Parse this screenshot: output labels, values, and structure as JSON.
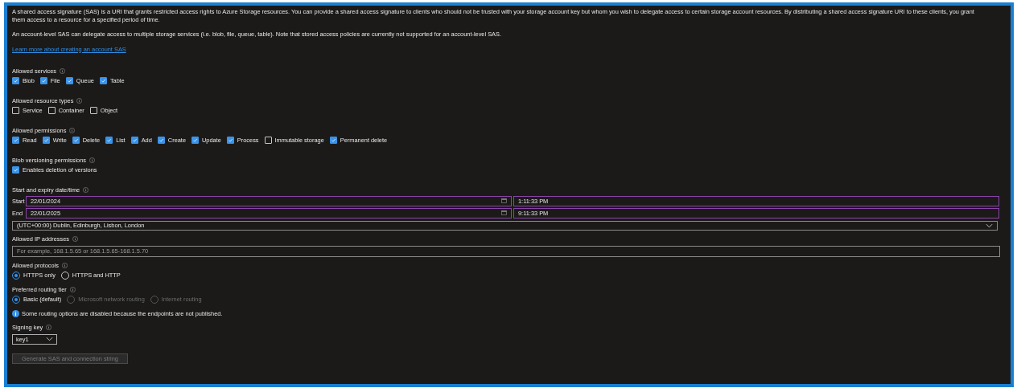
{
  "intro": [
    {
      "kind": "text",
      "text": "A shared access signature (SAS) is a URI that grants restricted access rights to Azure Storage resources. You can provide a shared access signature to clients who should not be trusted with your storage account key but whom you wish to delegate access to certain storage account resources. By distributing a shared access signature URI to these clients, you grant them access to a resource for a specified period of time."
    },
    {
      "kind": "text",
      "text": "An account-level SAS can delegate access to multiple storage services (i.e. blob, file, queue, table). Note that stored access policies are currently not supported for an account-level SAS."
    },
    {
      "kind": "link",
      "text": "Learn more about creating an account SAS"
    }
  ],
  "sections": [
    {
      "kind": "checkboxes",
      "label": "Allowed services",
      "options": [
        {
          "label": "Blob",
          "checked": true
        },
        {
          "label": "File",
          "checked": true
        },
        {
          "label": "Queue",
          "checked": true
        },
        {
          "label": "Table",
          "checked": true
        }
      ]
    },
    {
      "kind": "checkboxes",
      "label": "Allowed resource types",
      "options": [
        {
          "label": "Service",
          "checked": false
        },
        {
          "label": "Container",
          "checked": false
        },
        {
          "label": "Object",
          "checked": false
        }
      ]
    },
    {
      "kind": "checkboxes",
      "label": "Allowed permissions",
      "options": [
        {
          "label": "Read",
          "checked": true
        },
        {
          "label": "Write",
          "checked": true
        },
        {
          "label": "Delete",
          "checked": true
        },
        {
          "label": "List",
          "checked": true
        },
        {
          "label": "Add",
          "checked": true
        },
        {
          "label": "Create",
          "checked": true
        },
        {
          "label": "Update",
          "checked": true
        },
        {
          "label": "Process",
          "checked": true
        },
        {
          "label": "Immutable storage",
          "checked": false
        },
        {
          "label": "Permanent delete",
          "checked": true
        }
      ]
    },
    {
      "kind": "checkboxes",
      "label": "Blob versioning permissions",
      "options": [
        {
          "label": "Enables deletion of versions",
          "checked": true
        }
      ]
    },
    {
      "kind": "datetime",
      "label": "Start and expiry date/time",
      "rows": [
        {
          "label": "Start",
          "date": "22/01/2024",
          "time": "1:11:33 PM"
        },
        {
          "label": "End",
          "date": "22/01/2025",
          "time": "9:11:33 PM"
        }
      ],
      "timezone": "(UTC+00:00) Dublin, Edinburgh, Lisbon, London"
    },
    {
      "kind": "textfield",
      "label": "Allowed IP addresses",
      "placeholder": "For example, 168.1.5.65 or 168.1.5.65-168.1.5.70"
    },
    {
      "kind": "radios",
      "label": "Allowed protocols",
      "options": [
        {
          "label": "HTTPS only",
          "selected": true,
          "disabled": false
        },
        {
          "label": "HTTPS and HTTP",
          "selected": false,
          "disabled": false
        }
      ]
    },
    {
      "kind": "radios",
      "label": "Preferred routing tier",
      "options": [
        {
          "label": "Basic (default)",
          "selected": true,
          "disabled": false
        },
        {
          "label": "Microsoft network routing",
          "selected": false,
          "disabled": true
        },
        {
          "label": "Internet routing",
          "selected": false,
          "disabled": true
        }
      ]
    },
    {
      "kind": "info",
      "text": "Some routing options are disabled because the endpoints are not published."
    },
    {
      "kind": "select",
      "label": "Signing key",
      "value": "key1"
    },
    {
      "kind": "button",
      "text": "Generate SAS and connection string",
      "disabled": true
    }
  ]
}
